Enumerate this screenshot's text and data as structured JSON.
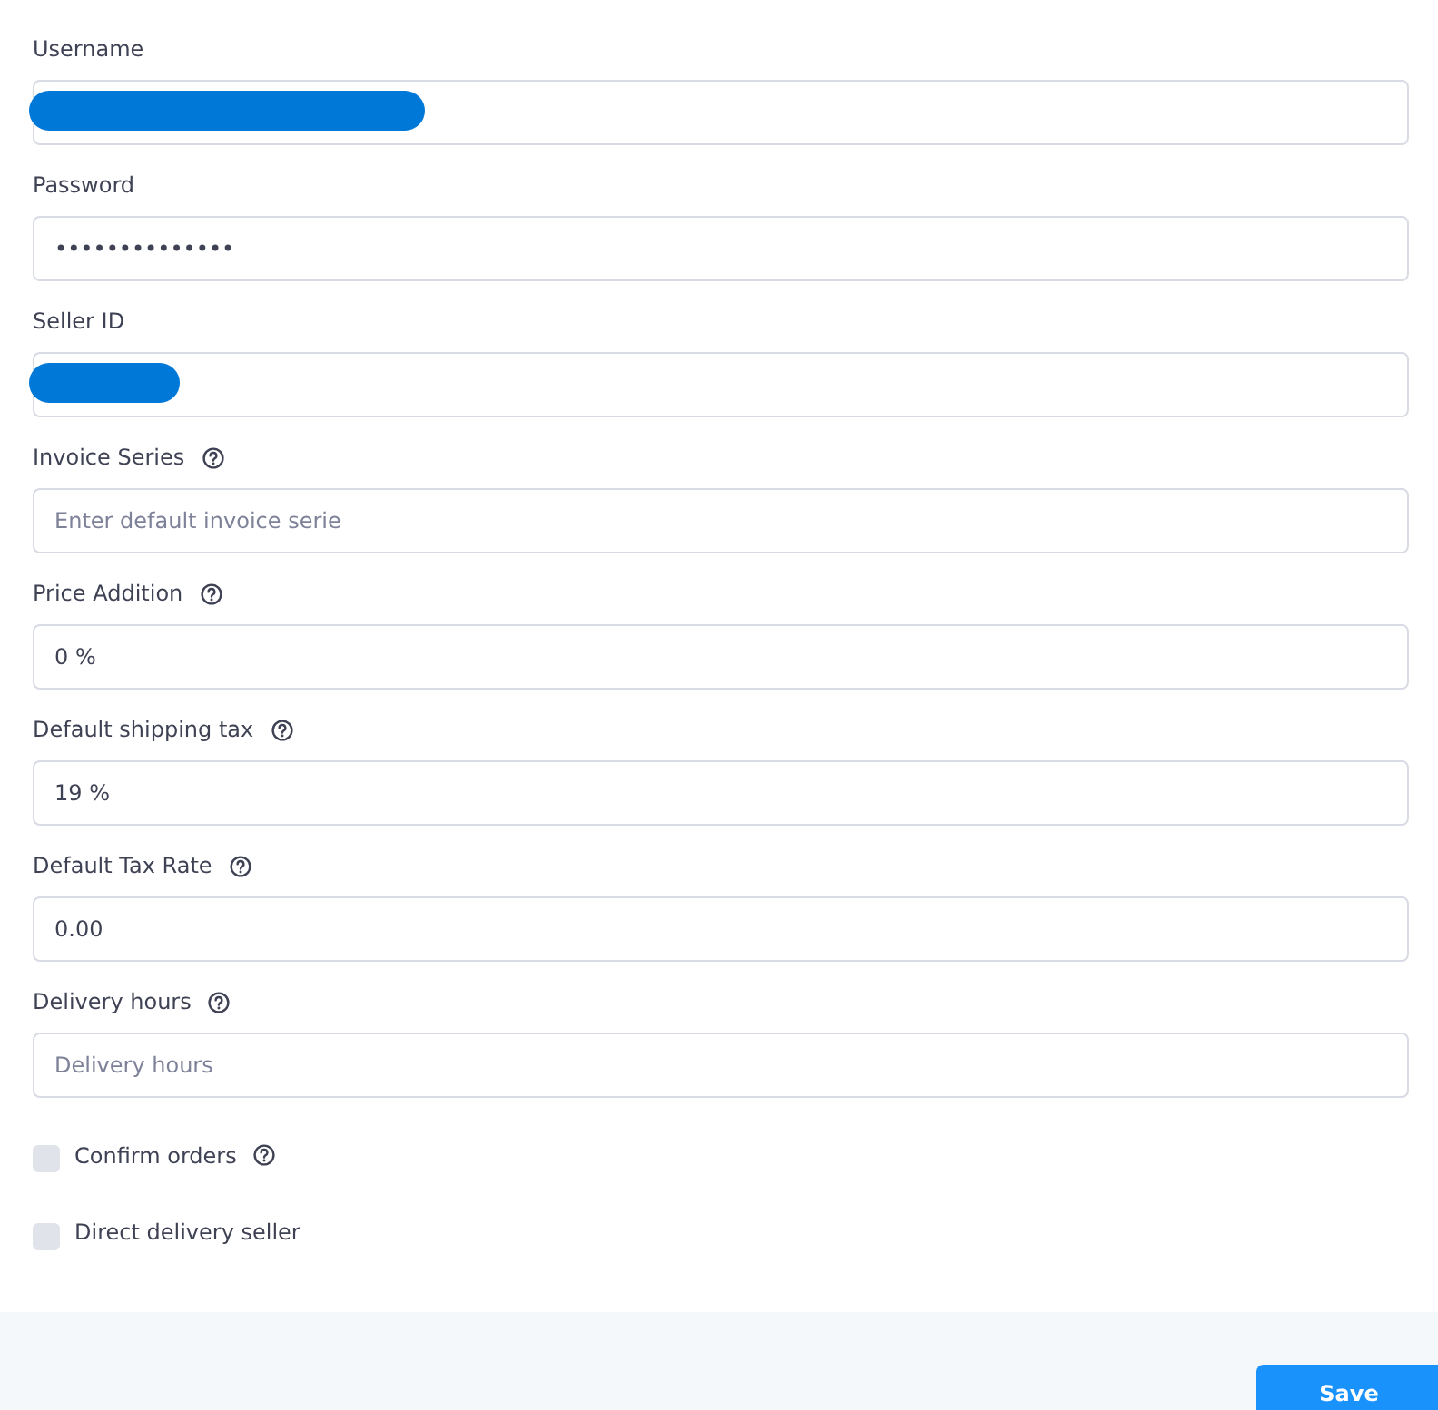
{
  "form": {
    "fields": [
      {
        "kind": "text",
        "label": "Username",
        "help": false,
        "redacted": true
      },
      {
        "kind": "text",
        "label": "Password",
        "help": false,
        "value": "••••••••••••••"
      },
      {
        "kind": "text",
        "label": "Seller ID",
        "help": false,
        "redacted": true
      },
      {
        "kind": "text",
        "label": "Invoice Series",
        "help": true,
        "placeholder": "Enter default invoice serie"
      },
      {
        "kind": "text",
        "label": "Price Addition",
        "help": true,
        "value": "0 %"
      },
      {
        "kind": "text",
        "label": "Default shipping tax",
        "help": true,
        "value": "19 %"
      },
      {
        "kind": "text",
        "label": "Default Tax Rate",
        "help": true,
        "value": "0.00"
      },
      {
        "kind": "text",
        "label": "Delivery hours",
        "help": true,
        "placeholder": "Delivery hours"
      },
      {
        "kind": "checkbox",
        "label": "Confirm orders",
        "help": true,
        "checked": false
      },
      {
        "kind": "checkbox",
        "label": "Direct delivery seller",
        "help": false,
        "checked": false
      }
    ]
  },
  "footer": {
    "buttons": [
      "Save"
    ]
  }
}
